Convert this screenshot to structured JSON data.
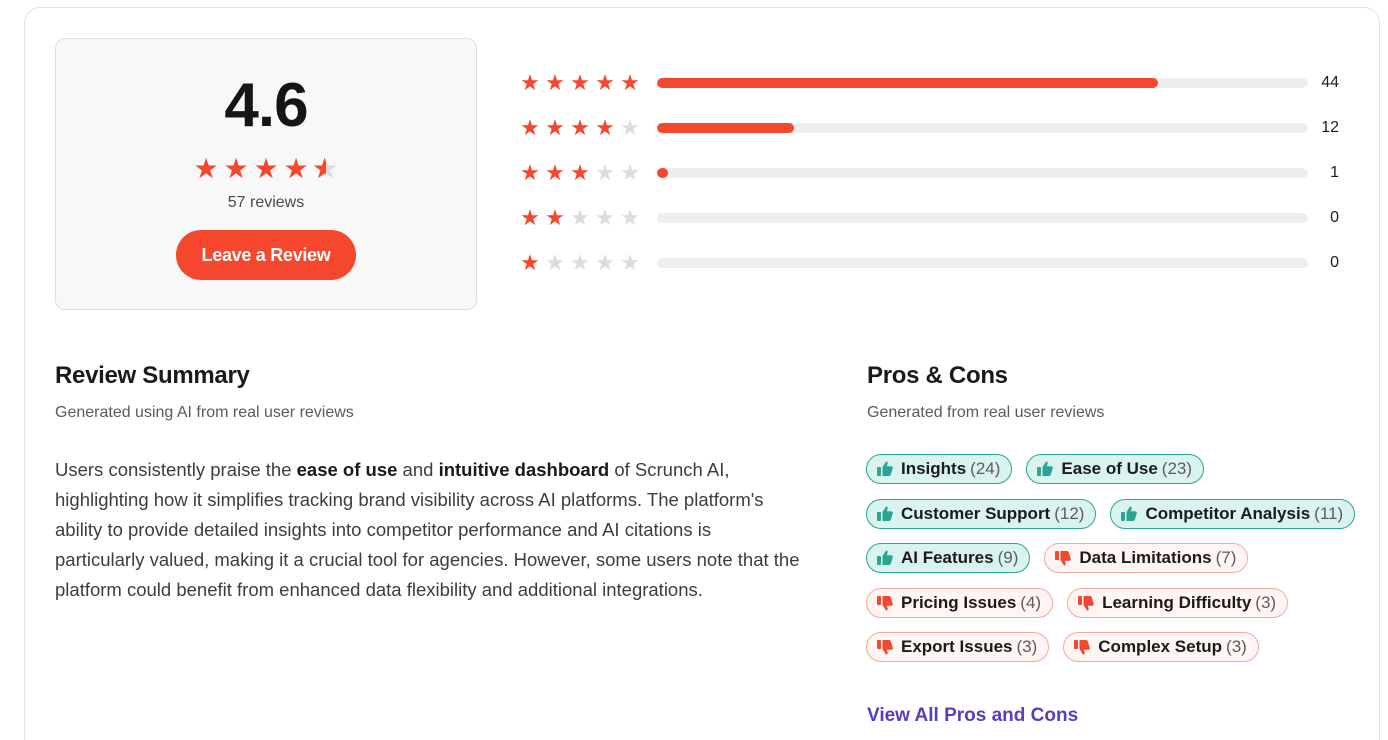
{
  "rating": {
    "score": "4.6",
    "score_value": 4.6,
    "reviews_label": "57 reviews",
    "leave_review_label": "Leave a Review"
  },
  "distribution": [
    {
      "stars": 5,
      "count": "44",
      "value": 44
    },
    {
      "stars": 4,
      "count": "12",
      "value": 12
    },
    {
      "stars": 3,
      "count": "1",
      "value": 1
    },
    {
      "stars": 2,
      "count": "0",
      "value": 0
    },
    {
      "stars": 1,
      "count": "0",
      "value": 0
    }
  ],
  "review_summary": {
    "title": "Review Summary",
    "subtitle": "Generated using AI from real user reviews",
    "text_parts": [
      {
        "text": "Users consistently praise the ",
        "bold": false
      },
      {
        "text": "ease of use",
        "bold": true
      },
      {
        "text": " and ",
        "bold": false
      },
      {
        "text": "intuitive dashboard",
        "bold": true
      },
      {
        "text": " of Scrunch AI, highlighting how it simplifies tracking brand visibility across AI platforms. The platform's ability to provide detailed insights into competitor performance and AI citations is particularly valued, making it a crucial tool for agencies. However, some users note that the platform could benefit from enhanced data flexibility and additional integrations.",
        "bold": false
      }
    ]
  },
  "pros_cons": {
    "title": "Pros & Cons",
    "subtitle": "Generated from real user reviews",
    "rows": [
      [
        {
          "type": "pro",
          "label": "Insights",
          "count": "(24)"
        },
        {
          "type": "pro",
          "label": "Ease of Use",
          "count": "(23)"
        }
      ],
      [
        {
          "type": "pro",
          "label": "Customer Support",
          "count": "(12)"
        },
        {
          "type": "pro",
          "label": "Competitor Analysis",
          "count": "(11)"
        }
      ],
      [
        {
          "type": "pro",
          "label": "AI Features",
          "count": "(9)"
        },
        {
          "type": "con",
          "label": "Data Limitations",
          "count": "(7)"
        }
      ],
      [
        {
          "type": "con",
          "label": "Pricing Issues",
          "count": "(4)"
        },
        {
          "type": "con",
          "label": "Learning Difficulty",
          "count": "(3)"
        }
      ],
      [
        {
          "type": "con",
          "label": "Export Issues",
          "count": "(3)"
        },
        {
          "type": "con",
          "label": "Complex Setup",
          "count": "(3)"
        }
      ]
    ],
    "view_all_label": "View All Pros and Cons"
  },
  "colors": {
    "accent": "#f4472e",
    "pro_border": "#2ba593",
    "pro_bg": "#d9f3ef",
    "con_border": "#f5a89b",
    "con_bg": "#fff5f3",
    "link": "#5b3dbb"
  },
  "icons": {
    "pro": "thumbs-up-icon",
    "con": "thumbs-down-icon",
    "star": "star-icon"
  }
}
